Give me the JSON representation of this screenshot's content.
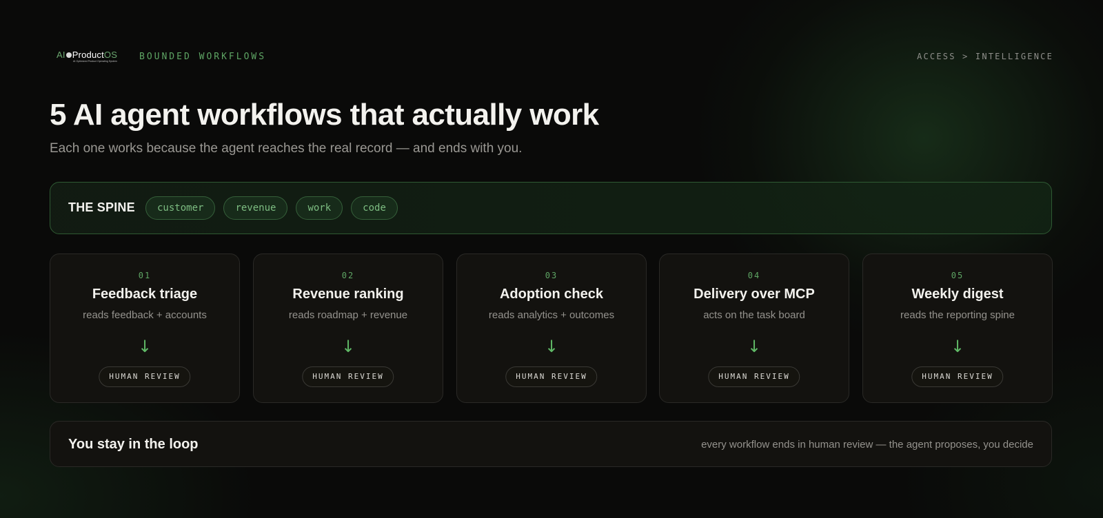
{
  "header": {
    "logo": {
      "ai": "AI",
      "product": "Product",
      "os": "OS",
      "tagline": "AI Optimized Product Operating System"
    },
    "section_tag": "BOUNDED WORKFLOWS",
    "breadcrumb": "ACCESS > INTELLIGENCE"
  },
  "hero": {
    "title": "5 AI agent workflows that actually work",
    "subtitle": "Each one works because the agent reaches the real record — and ends with you."
  },
  "spine": {
    "label": "THE SPINE",
    "tags": [
      "customer",
      "revenue",
      "work",
      "code"
    ]
  },
  "workflows": [
    {
      "number": "01",
      "title": "Feedback triage",
      "description": "reads feedback + accounts",
      "arrow": "↓",
      "badge": "HUMAN REVIEW"
    },
    {
      "number": "02",
      "title": "Revenue ranking",
      "description": "reads roadmap + revenue",
      "arrow": "↓",
      "badge": "HUMAN REVIEW"
    },
    {
      "number": "03",
      "title": "Adoption check",
      "description": "reads analytics + outcomes",
      "arrow": "↓",
      "badge": "HUMAN REVIEW"
    },
    {
      "number": "04",
      "title": "Delivery over MCP",
      "description": "acts on the task board",
      "arrow": "↓",
      "badge": "HUMAN REVIEW"
    },
    {
      "number": "05",
      "title": "Weekly digest",
      "description": "reads the reporting spine",
      "arrow": "↓",
      "badge": "HUMAN REVIEW"
    }
  ],
  "loop": {
    "title": "You stay in the loop",
    "text": "every workflow ends in human review — the agent proposes, you decide"
  },
  "colors": {
    "background": "#0a0a09",
    "accent_green": "#5ea564",
    "card_background": "#13120f",
    "spine_border": "#2f5a33"
  }
}
